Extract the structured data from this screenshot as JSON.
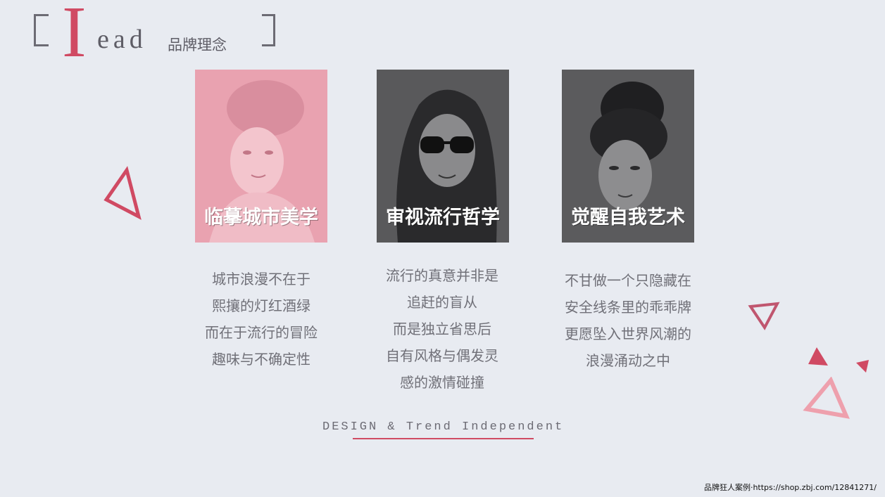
{
  "header": {
    "big_letter": "I",
    "title_rest": "ead",
    "title_cn": "品牌理念"
  },
  "cards": [
    {
      "label": "临摹城市美学",
      "tint": "#e8a0ae"
    },
    {
      "label": "审视流行哲学",
      "tint": "#5a5a5c"
    },
    {
      "label": "觉醒自我艺术",
      "tint": "#5c5c5e"
    }
  ],
  "paragraphs": [
    [
      "城市浪漫不在于",
      "熙攘的灯红酒绿",
      "而在于流行的冒险",
      "趣味与不确定性"
    ],
    [
      "流行的真意并非是",
      "追赶的盲从",
      "而是独立省思后",
      "自有风格与偶发灵",
      "感的激情碰撞"
    ],
    [
      "不甘做一个只隐藏在",
      "安全线条里的乖乖牌",
      "更愿坠入世界风潮的",
      "浪漫涌动之中"
    ]
  ],
  "footer": {
    "tagline": "DESIGN & Trend Independent"
  },
  "watermark": "品牌狂人案例·https://shop.zbj.com/12841271/",
  "colors": {
    "accent": "#d04a63",
    "accent_light": "#eea0ad",
    "text_gray": "#707078",
    "background": "#e8ebf1"
  }
}
